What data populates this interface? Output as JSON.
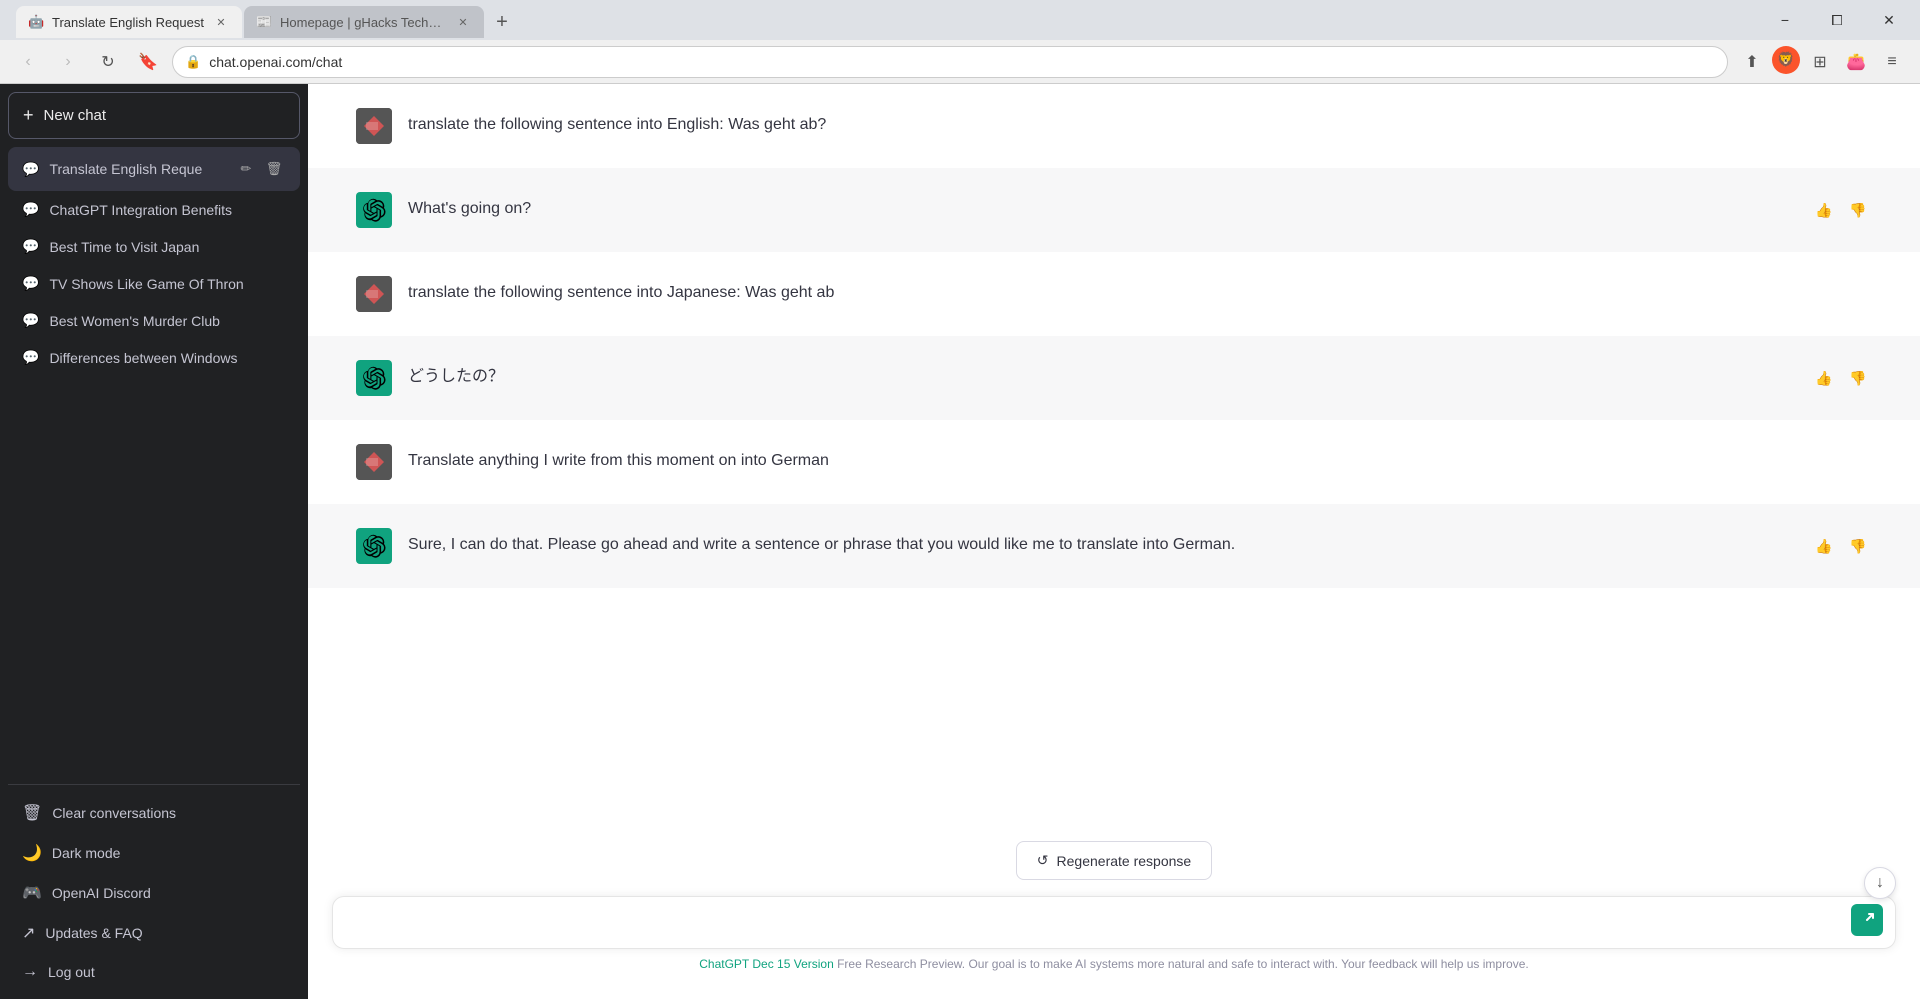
{
  "browser": {
    "tabs": [
      {
        "id": "tab-1",
        "title": "Translate English Request",
        "favicon": "🤖",
        "active": true,
        "url": "chat.openai.com/chat"
      },
      {
        "id": "tab-2",
        "title": "Homepage | gHacks Technology News",
        "favicon": "📰",
        "active": false,
        "url": "ghacks.net"
      }
    ],
    "address": "chat.openai.com/chat",
    "nav": {
      "back_disabled": true,
      "forward_disabled": true
    }
  },
  "sidebar": {
    "new_chat_label": "New chat",
    "chat_list": [
      {
        "id": "chat-active",
        "label": "Translate English Reque",
        "active": true
      },
      {
        "id": "chat-2",
        "label": "ChatGPT Integration Benefits",
        "active": false
      },
      {
        "id": "chat-3",
        "label": "Best Time to Visit Japan",
        "active": false
      },
      {
        "id": "chat-4",
        "label": "TV Shows Like Game Of Thron",
        "active": false
      },
      {
        "id": "chat-5",
        "label": "Best Women's Murder Club",
        "active": false
      },
      {
        "id": "chat-6",
        "label": "Differences between Windows",
        "active": false
      }
    ],
    "actions": [
      {
        "id": "clear-conversations",
        "icon": "🗑",
        "label": "Clear conversations"
      },
      {
        "id": "dark-mode",
        "icon": "🌙",
        "label": "Dark mode"
      },
      {
        "id": "openai-discord",
        "icon": "🎮",
        "label": "OpenAI Discord"
      },
      {
        "id": "updates-faq",
        "icon": "↗",
        "label": "Updates & FAQ"
      },
      {
        "id": "log-out",
        "icon": "→",
        "label": "Log out"
      }
    ]
  },
  "chat": {
    "messages": [
      {
        "id": "msg-1",
        "role": "user",
        "content": "translate the following sentence into English: Was geht ab?",
        "has_actions": false
      },
      {
        "id": "msg-2",
        "role": "assistant",
        "content": "What's going on?",
        "has_actions": true
      },
      {
        "id": "msg-3",
        "role": "user",
        "content": "translate the following sentence into Japanese: Was geht ab",
        "has_actions": false
      },
      {
        "id": "msg-4",
        "role": "assistant",
        "content": "どうしたの？",
        "has_actions": true
      },
      {
        "id": "msg-5",
        "role": "user",
        "content": "Translate anything I write from this moment on into German",
        "has_actions": false
      },
      {
        "id": "msg-6",
        "role": "assistant",
        "content": "Sure, I can do that. Please go ahead and write a sentence or phrase that you would like me to translate into German.",
        "has_actions": true
      }
    ],
    "input_placeholder": "",
    "regenerate_label": "Regenerate response",
    "footer_text": " Free Research Preview. Our goal is to make AI systems more natural and safe to interact with. Your feedback will help us improve.",
    "footer_link_text": "ChatGPT Dec 15 Version",
    "footer_link_url": "#"
  },
  "icons": {
    "new_chat": "+",
    "chat_bubble": "💬",
    "pencil": "✏",
    "trash": "🗑",
    "thumbs_up": "👍",
    "thumbs_down": "👎",
    "send": "▶",
    "scroll_down": "↓",
    "regenerate": "↺",
    "back": "‹",
    "forward": "›",
    "refresh": "↻",
    "bookmark": "🔖",
    "shield": "🛡",
    "sidebar_toggle": "⊞",
    "wallet": "👛",
    "menu": "≡"
  }
}
